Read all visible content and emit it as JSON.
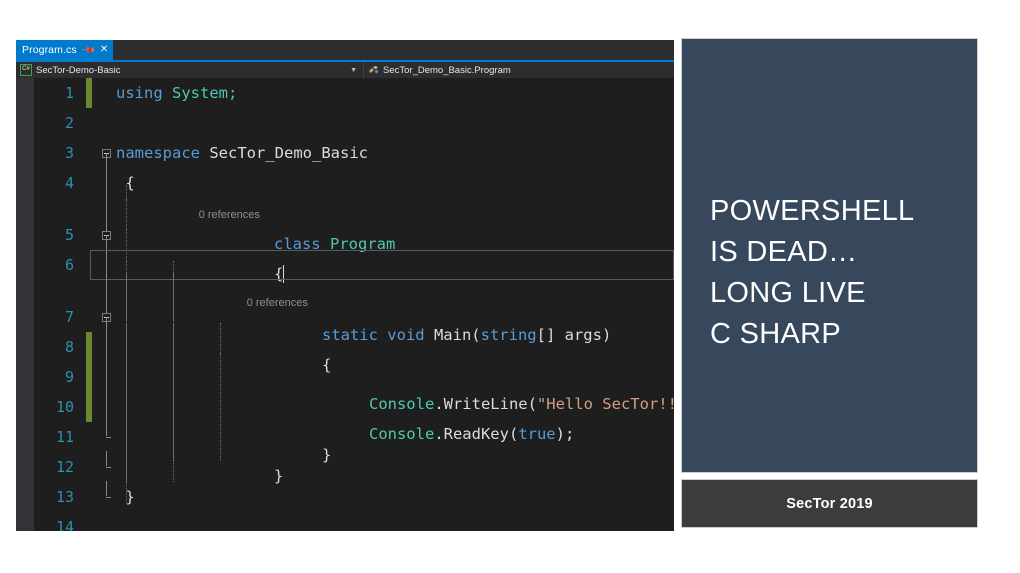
{
  "slide": {
    "title_lines": [
      "POWERSHELL",
      "IS DEAD…",
      "LONG LIVE",
      "C SHARP"
    ],
    "footer": "SecTor 2019",
    "colors": {
      "title_panel_bg": "#37485C",
      "footer_panel_bg": "#3C3C3B",
      "title_text": "#FFFFFF",
      "slide_bg": "#FFFFFF"
    }
  },
  "editor": {
    "tab": {
      "label": "Program.cs",
      "pin_icon": "pin-icon",
      "close_icon": "close-icon",
      "active_color": "#007ACC"
    },
    "navbar": {
      "project_icon": "csharp-project-icon",
      "project_label": "SecTor-Demo-Basic",
      "member_icon": "class-member-icon",
      "member_label": "SecTor_Demo_Basic.Program",
      "chevron_icon": "chevron-down-icon"
    },
    "colors": {
      "background": "#1E1E1E",
      "gutter": "#333337",
      "line_number": "#2B91AF",
      "keyword": "#569CD6",
      "type": "#4EC9B0",
      "string": "#D69D85",
      "plain": "#DCDCDC",
      "codelens": "#919191",
      "change_bar_saved": "#68892F"
    },
    "codelens": {
      "class_references": "0 references",
      "method_references": "0 references"
    },
    "lines": [
      {
        "n": "1",
        "text": "using System;"
      },
      {
        "n": "2",
        "text": ""
      },
      {
        "n": "3",
        "text": "namespace SecTor_Demo_Basic"
      },
      {
        "n": "4",
        "text": "{"
      },
      {
        "n": "5",
        "text": "class Program"
      },
      {
        "n": "6",
        "text": "{"
      },
      {
        "n": "7",
        "text": "static void Main(string[] args)"
      },
      {
        "n": "8",
        "text": "{"
      },
      {
        "n": "9",
        "text": "Console.WriteLine(\"Hello SecTor!!!\");"
      },
      {
        "n": "10",
        "text": "Console.ReadKey(true);"
      },
      {
        "n": "11",
        "text": "}"
      },
      {
        "n": "12",
        "text": "}"
      },
      {
        "n": "13",
        "text": "}"
      },
      {
        "n": "14",
        "text": ""
      }
    ],
    "tokens": {
      "using": "using",
      "system": "System;",
      "namespace": "namespace",
      "namespace_name": "SecTor_Demo_Basic",
      "brace_open": "{",
      "brace_close": "}",
      "class": "class",
      "class_name": "Program",
      "static_void": "static void ",
      "main": "Main(",
      "string_kw": "string",
      "args": "[] args)",
      "console": "Console",
      "writeline": ".WriteLine(",
      "hello_string": "\"Hello SecTor!!!\"",
      "stmt_end": ");",
      "readkey": ".ReadKey(",
      "true_kw": "true",
      "paren_semi": ");"
    }
  }
}
